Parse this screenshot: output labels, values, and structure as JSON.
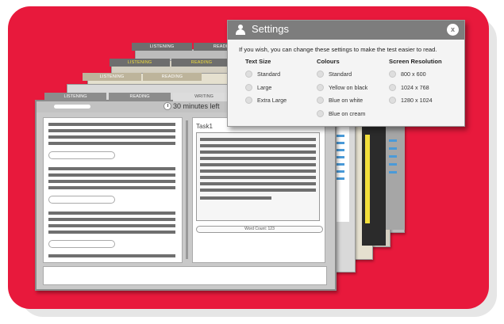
{
  "back_windows": {
    "tab_labels": [
      "LISTENING",
      "READING",
      "LISTENING",
      "READING",
      "LISTENING",
      "READING"
    ]
  },
  "front_window": {
    "tabs": [
      {
        "label": "LISTENING"
      },
      {
        "label": "READING"
      },
      {
        "label": "WRITING"
      }
    ],
    "timer_text": "30 minutes left",
    "task_label": "Task1",
    "word_count": "Word Count: 123"
  },
  "settings": {
    "title": "Settings",
    "close_label": "x",
    "intro": "If you wish, you can change these settings to make the test easier to read.",
    "columns": [
      {
        "heading": "Text Size",
        "options": [
          "Standard",
          "Large",
          "Extra Large"
        ]
      },
      {
        "heading": "Colours",
        "options": [
          "Standard",
          "Yellow on black",
          "Blue on white",
          "Blue on cream"
        ]
      },
      {
        "heading": "Screen Resolution",
        "options": [
          "800 x 600",
          "1024 x 768",
          "1280 x 1024"
        ]
      }
    ]
  },
  "colors": {
    "background_card": "#e8193c",
    "dialog_header": "#7d7d7d",
    "highlight_yellow": "#f3df3a"
  }
}
